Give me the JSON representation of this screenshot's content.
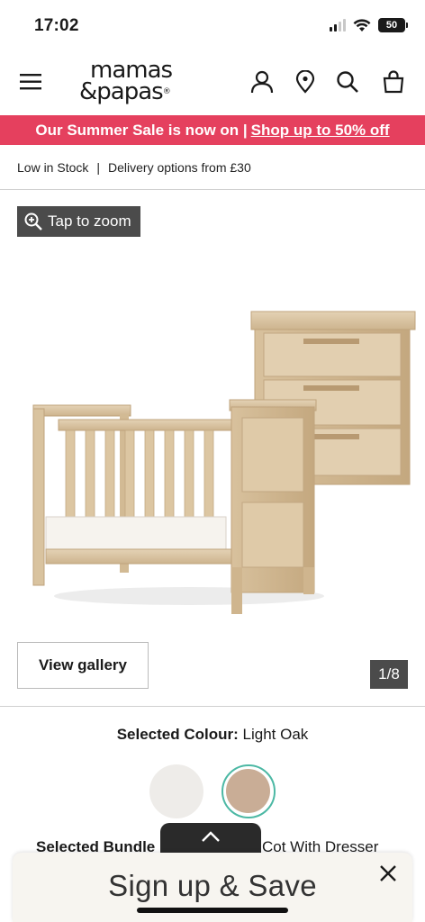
{
  "status_bar": {
    "time": "17:02",
    "battery": "50"
  },
  "header": {
    "logo_line1": "mamas",
    "logo_line2": "&papas",
    "logo_reg": "®",
    "icons": [
      "menu-icon",
      "account-icon",
      "store-locator-icon",
      "search-icon",
      "basket-icon"
    ]
  },
  "promo": {
    "text": "Our Summer Sale is now on |",
    "link": "Shop up to 50% off",
    "color": "#e5405e"
  },
  "stock": {
    "status": "Low in Stock",
    "separator": "|",
    "delivery": "Delivery options from £30"
  },
  "gallery": {
    "zoom_label": "Tap to zoom",
    "view_label": "View gallery",
    "counter": "1/8"
  },
  "product": {
    "colour_label": "Selected Colour:",
    "colour_value": "Light Oak",
    "swatches": [
      {
        "name": "white",
        "color": "#eeece9",
        "selected": false
      },
      {
        "name": "light-oak",
        "color": "#c9ad96",
        "selected": true
      }
    ],
    "bundle_label": "Selected Bundle",
    "bundle_value": "Cot With Dresser"
  },
  "signup": {
    "label": "Sign up & Save"
  },
  "colors": {
    "accent": "#4cb8a4",
    "overlay_dark": "#4b4b4b"
  }
}
